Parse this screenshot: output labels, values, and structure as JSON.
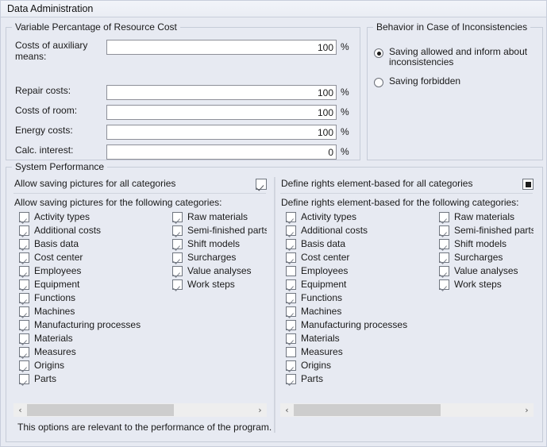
{
  "window": {
    "title": "Data Administration"
  },
  "variable_group": {
    "label": "Variable Percantage of Resource Cost",
    "unit": "%",
    "fields": [
      {
        "label": "Costs of auxiliary\nmeans:",
        "value": "100",
        "unit": "%"
      },
      {
        "label": "Repair costs:",
        "value": "100",
        "unit": "%"
      },
      {
        "label": "Costs of room:",
        "value": "100",
        "unit": "%"
      },
      {
        "label": "Energy costs:",
        "value": "100",
        "unit": "%"
      },
      {
        "label": "Calc. interest:",
        "value": "0",
        "unit": "%"
      }
    ]
  },
  "behavior_group": {
    "label": "Behavior in Case of Inconsistencies",
    "options": [
      {
        "label": "Saving allowed and inform about\ninconsistencies",
        "selected": true
      },
      {
        "label": "Saving forbidden",
        "selected": false
      }
    ]
  },
  "system_group": {
    "label": "System Performance",
    "footer_note": "This options are relevant to the performance of the program.",
    "left": {
      "header": "Allow saving pictures for all categories",
      "header_state": "checked",
      "subheader": "Allow saving pictures for the following categories:",
      "column1": [
        {
          "label": "Activity types",
          "state": "checked"
        },
        {
          "label": "Additional costs",
          "state": "checked"
        },
        {
          "label": "Basis data",
          "state": "checked"
        },
        {
          "label": "Cost center",
          "state": "checked"
        },
        {
          "label": "Employees",
          "state": "checked"
        },
        {
          "label": "Equipment",
          "state": "checked"
        },
        {
          "label": "Functions",
          "state": "checked"
        },
        {
          "label": "Machines",
          "state": "checked"
        },
        {
          "label": "Manufacturing processes",
          "state": "checked"
        },
        {
          "label": "Materials",
          "state": "checked"
        },
        {
          "label": "Measures",
          "state": "checked"
        },
        {
          "label": "Origins",
          "state": "checked"
        },
        {
          "label": "Parts",
          "state": "checked"
        }
      ],
      "column2": [
        {
          "label": "Raw materials",
          "state": "checked"
        },
        {
          "label": "Semi-finished parts",
          "state": "checked"
        },
        {
          "label": "Shift models",
          "state": "checked"
        },
        {
          "label": "Surcharges",
          "state": "checked"
        },
        {
          "label": "Value analyses",
          "state": "checked"
        },
        {
          "label": "Work steps",
          "state": "checked"
        }
      ],
      "scrollbar": {
        "left_arrow": "‹",
        "right_arrow": "›"
      }
    },
    "right": {
      "header": "Define rights element-based for all categories",
      "header_state": "indeterminate",
      "subheader": "Define rights element-based for the following categories:",
      "column1": [
        {
          "label": "Activity types",
          "state": "checked"
        },
        {
          "label": "Additional costs",
          "state": "checked"
        },
        {
          "label": "Basis data",
          "state": "checked"
        },
        {
          "label": "Cost center",
          "state": "checked"
        },
        {
          "label": "Employees",
          "state": "unchecked"
        },
        {
          "label": "Equipment",
          "state": "checked"
        },
        {
          "label": "Functions",
          "state": "checked"
        },
        {
          "label": "Machines",
          "state": "checked"
        },
        {
          "label": "Manufacturing processes",
          "state": "checked"
        },
        {
          "label": "Materials",
          "state": "checked"
        },
        {
          "label": "Measures",
          "state": "unchecked"
        },
        {
          "label": "Origins",
          "state": "checked"
        },
        {
          "label": "Parts",
          "state": "checked"
        }
      ],
      "column2": [
        {
          "label": "Raw materials",
          "state": "checked"
        },
        {
          "label": "Semi-finished parts",
          "state": "checked"
        },
        {
          "label": "Shift models",
          "state": "checked"
        },
        {
          "label": "Surcharges",
          "state": "checked"
        },
        {
          "label": "Value analyses",
          "state": "checked"
        },
        {
          "label": "Work steps",
          "state": "checked"
        }
      ],
      "scrollbar": {
        "left_arrow": "‹",
        "right_arrow": "›"
      }
    }
  },
  "colors": {
    "background": "#e7eaf2",
    "border": "#c6ccd8",
    "field_border": "#8e9099",
    "scroll_thumb": "#cdcdcd"
  }
}
